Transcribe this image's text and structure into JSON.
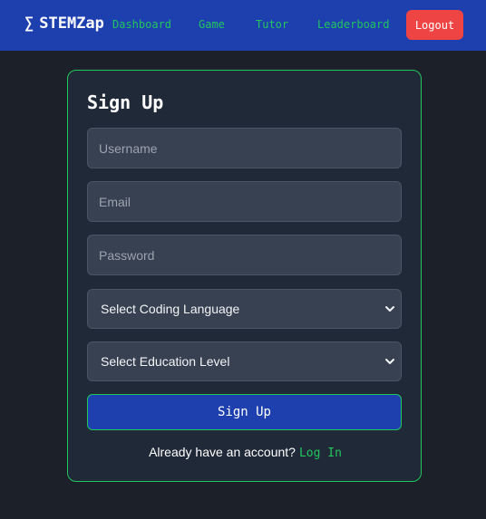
{
  "navbar": {
    "brand_symbol": "∑",
    "brand_name": "STEMZap",
    "links": [
      "Dashboard",
      "Game",
      "Tutor",
      "Leaderboard"
    ],
    "logout_label": "Logout"
  },
  "form": {
    "title": "Sign Up",
    "username_placeholder": "Username",
    "email_placeholder": "Email",
    "password_placeholder": "Password",
    "coding_language_selected": "Select Coding Language",
    "education_level_selected": "Select Education Level",
    "submit_label": "Sign Up",
    "footer_prompt": "Already have an account?",
    "login_link": "Log In"
  },
  "colors": {
    "navbar_bg": "#1e40af",
    "accent_green": "#22c55e",
    "logout_red": "#ef4444",
    "page_bg": "#1c2028",
    "card_bg": "#1f2937",
    "input_bg": "#374151"
  },
  "icons": {
    "select_chevron": "chevron-down-icon"
  }
}
